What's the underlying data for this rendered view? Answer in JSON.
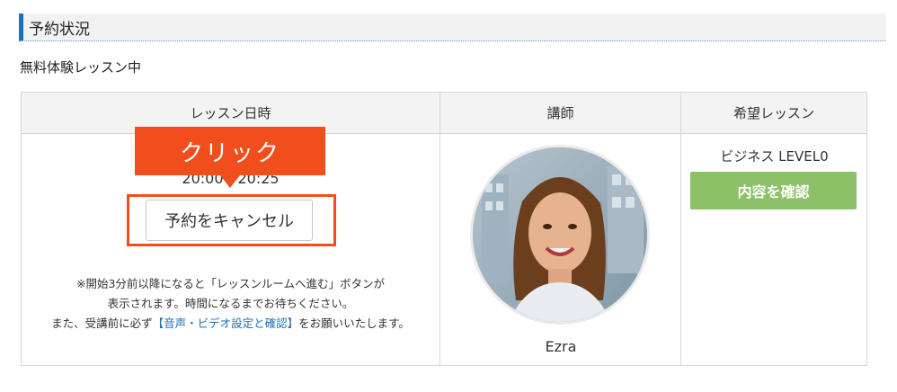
{
  "section": {
    "title": "予約状況"
  },
  "status": {
    "text": "無料体験レッスン中"
  },
  "table": {
    "headers": [
      "レッスン日時",
      "講師",
      "希望レッスン"
    ],
    "lesson_time": "20:00 - 20:25",
    "cancel_button": "予約をキャンセル",
    "callout": "クリック",
    "notice": {
      "line1": "※開始3分前以降になると「レッスンルームへ進む」ボタンが",
      "line2": "表示されます。時間になるまでお待ちください。",
      "line3_prefix": "また、受講前に必ず",
      "line3_link": "【音声・ビデオ設定と確認】",
      "line3_suffix": "をお願いいたします。"
    },
    "teacher_name": "Ezra",
    "course_name": "ビジネス LEVEL0",
    "detail_button": "内容を確認"
  },
  "colors": {
    "accent_blue": "#1f6fb2",
    "callout_orange": "#f04e1c",
    "button_green": "#8cc168"
  },
  "icons": {
    "avatar": "teacher-avatar-photo"
  }
}
